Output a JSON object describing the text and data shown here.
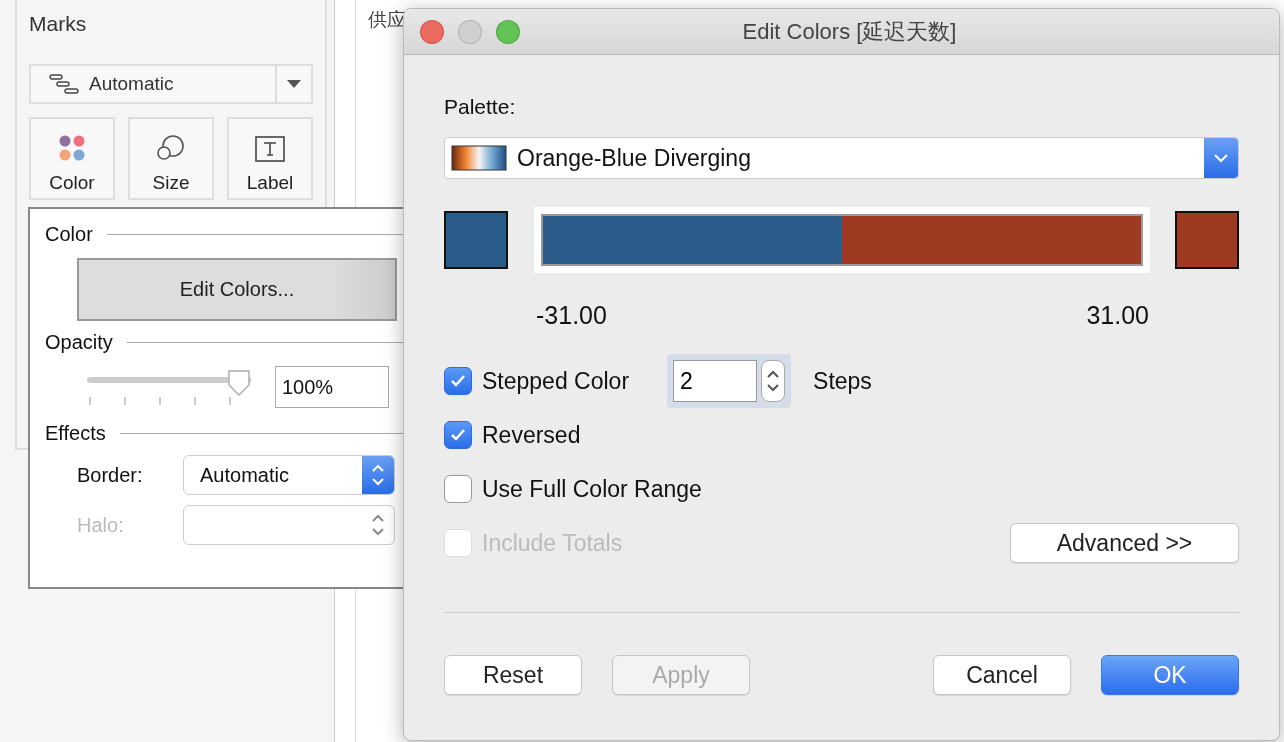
{
  "marks": {
    "title": "Marks",
    "mark_type": "Automatic",
    "cards": [
      {
        "kind": "color",
        "label": "Color"
      },
      {
        "kind": "size",
        "label": "Size"
      },
      {
        "kind": "label",
        "label": "Label"
      }
    ]
  },
  "color_popover": {
    "color_section": "Color",
    "edit_button": "Edit Colors...",
    "opacity_section": "Opacity",
    "opacity": {
      "level": 1,
      "value": "100%"
    },
    "effects_section": "Effects",
    "border": {
      "label": "Border:",
      "value": "Automatic",
      "disabled": false
    },
    "halo": {
      "label": "Halo:",
      "disabled": true
    }
  },
  "canvas": {
    "header_text": "供应"
  },
  "dialog": {
    "title": "Edit Colors [延迟天数]",
    "palette_label": "Palette:",
    "palette": "Orange-Blue Diverging",
    "swatches": [
      {
        "color": "#2b5c8a"
      },
      {
        "color": "#9e3a22"
      }
    ],
    "range_min": "-31.00",
    "range_max": "31.00",
    "options": [
      {
        "label": "Stepped Color",
        "checked": true,
        "disabled": false
      },
      {
        "label": "Reversed",
        "checked": true,
        "disabled": false
      },
      {
        "label": "Use Full Color Range",
        "checked": false,
        "disabled": false
      },
      {
        "label": "Include Totals",
        "checked": false,
        "disabled": true
      }
    ],
    "steps": {
      "value": "2",
      "label": "Steps"
    },
    "advanced_button": "Advanced >>",
    "buttons": [
      {
        "label": "Reset",
        "kind": "normal",
        "disabled": false
      },
      {
        "label": "Apply",
        "kind": "normal",
        "disabled": true
      },
      {
        "label": "Cancel",
        "kind": "normal",
        "disabled": false
      },
      {
        "label": "OK",
        "kind": "default",
        "disabled": false
      }
    ]
  }
}
